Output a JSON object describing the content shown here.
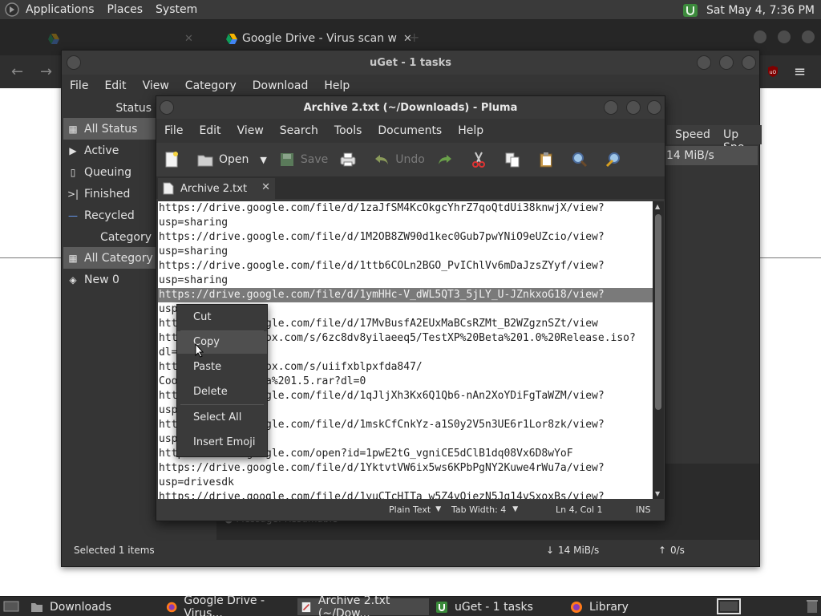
{
  "top_panel": {
    "menus": [
      "Applications",
      "Places",
      "System"
    ],
    "clock": "Sat May  4,  7:36 PM"
  },
  "browser": {
    "tabs": [
      {
        "label": "",
        "faded": true
      },
      {
        "label": "Google Drive - Virus scan w"
      }
    ]
  },
  "uget": {
    "title": "uGet - 1 tasks",
    "menus": [
      "File",
      "Edit",
      "View",
      "Category",
      "Download",
      "Help"
    ],
    "sidebar_status_header": "Status",
    "status_items": [
      {
        "label": "All Status",
        "icon": "all-status-icon"
      },
      {
        "label": "Active",
        "icon": "play-icon"
      },
      {
        "label": "Queuing",
        "icon": "document-icon"
      },
      {
        "label": "Finished",
        "icon": "finish-icon"
      },
      {
        "label": "Recycled",
        "icon": "minus-icon"
      }
    ],
    "sidebar_category_header": "Category",
    "category_items": [
      {
        "label": "All Category"
      },
      {
        "label": "New 0"
      }
    ],
    "columns": [
      "Speed",
      "Up Spe"
    ],
    "row_speed": "14 MiB/s",
    "message_label": "Message:",
    "message_value": "Resumable",
    "status_selected": "Selected 1 items",
    "status_down": "14 MiB/s",
    "status_up": "0/s"
  },
  "pluma": {
    "title": "Archive 2.txt (~/Downloads) - Pluma",
    "menus": [
      "File",
      "Edit",
      "View",
      "Search",
      "Tools",
      "Documents",
      "Help"
    ],
    "toolbar": {
      "open": "Open",
      "save": "Save",
      "undo": "Undo"
    },
    "tab_label": "Archive 2.txt",
    "lines": [
      "https://drive.google.com/file/d/1zaJfSM4KcOkgcYhrZ7qoQtdUi38knwjX/view?",
      "usp=sharing",
      "https://drive.google.com/file/d/1M2OB8ZW90d1kec0Gub7pwYNiO9eUZcio/view?",
      "usp=sharing",
      "https://drive.google.com/file/d/1ttb6COLn2BGO_PvIChlVv6mDaJzsZYyf/view?",
      "usp=sharing",
      "https://drive.google.com/file/d/1ymHHc-V_dWL5QT3_5jLY_U-JZnkxoG18/view?",
      "usp=sharing",
      "https://drive.google.com/file/d/17MvBusfA2EUxMaBCsRZMt_B2WZgznSZt/view",
      "https://www.dropbox.com/s/6zc8dv8yilaeeq5/TestXP%20Beta%201.0%20Release.iso?",
      "dl=0",
      "https://www.dropbox.com/s/uiifxblpxfda847/",
      "CoolHacksXP%20Beta%201.5.rar?dl=0",
      "https://drive.google.com/file/d/1qJljXh3Kx6Q1Qb6-nAn2XoYDiFgTaWZM/view?",
      "usp=sharing",
      "https://drive.google.com/file/d/1mskCfCnkYz-a1S0y2V5n3UE6r1Lor8zk/view?",
      "usp=sharing",
      "https://drive.google.com/open?id=1pwE2tG_vgniCE5dClB1dq08Vx6D8wYoF",
      "https://drive.google.com/file/d/1YktvtVW6ix5ws6KPbPgNY2Kuwe4rWu7a/view?",
      "usp=drivesdk",
      "https://drive.google.com/file/d/1yuCTcHITa_w5Z4yOiezN5Jg14vSxoxBs/view?"
    ],
    "status": {
      "mode": "Plain Text",
      "tab_width": "Tab Width:  4",
      "position": "Ln 4, Col 1",
      "ins": "INS"
    }
  },
  "context_menu": {
    "items": [
      "Cut",
      "Copy",
      "Paste",
      "Delete",
      "Select All",
      "Insert Emoji"
    ],
    "highlighted": "Copy"
  },
  "taskbar": {
    "items": [
      {
        "label": "Downloads",
        "icon": "folder-icon"
      },
      {
        "label": "Google Drive - Virus...",
        "icon": "firefox-icon"
      },
      {
        "label": "Archive 2.txt (~/Dow...",
        "icon": "text-editor-icon"
      },
      {
        "label": "uGet - 1 tasks",
        "icon": "uget-icon"
      },
      {
        "label": "Library",
        "icon": "firefox-icon"
      }
    ]
  }
}
